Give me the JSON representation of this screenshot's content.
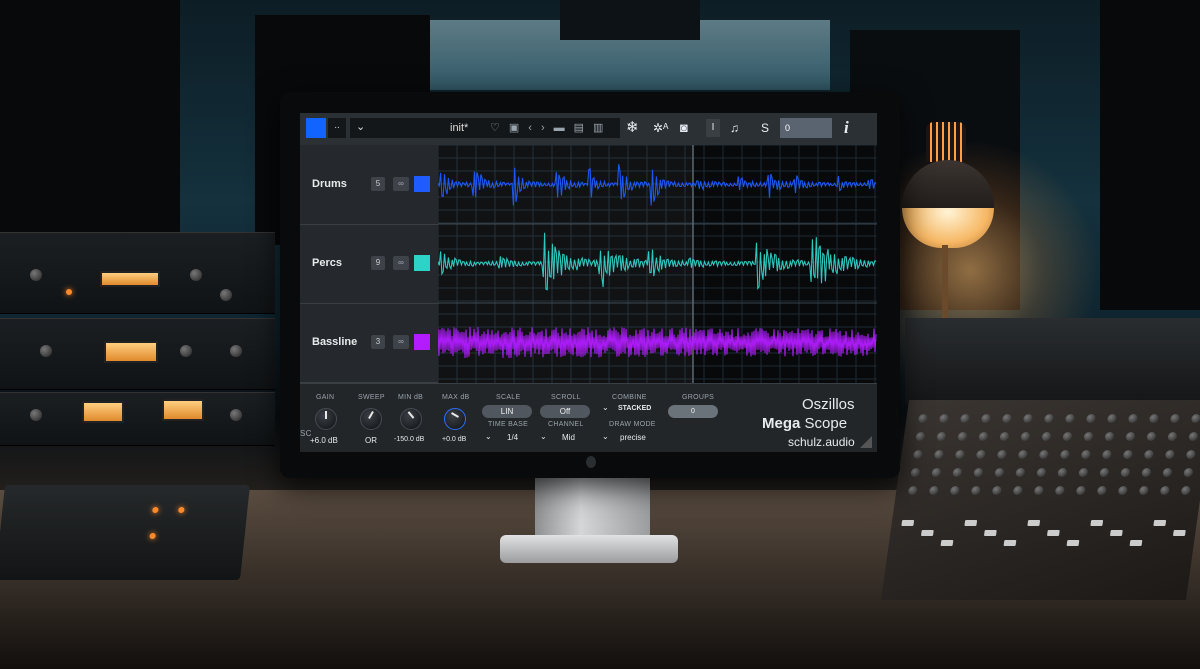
{
  "topbar": {
    "small_button": "..",
    "preset_chevron": "⌄",
    "preset_name": "init*",
    "icons": [
      "heart-icon",
      "save-icon",
      "prev-icon",
      "next-icon",
      "folder-icon",
      "copy-icon",
      "paste-icon"
    ],
    "number_field": "0"
  },
  "tracks": [
    {
      "name": "Drums",
      "num": "5",
      "link": "∞",
      "color": "#1e5cff"
    },
    {
      "name": "Percs",
      "num": "9",
      "link": "∞",
      "color": "#2ed3c8"
    },
    {
      "name": "Bassline",
      "num": "3",
      "link": "∞",
      "color": "#b21cff"
    }
  ],
  "controls": {
    "gain": {
      "label": "GAIN",
      "value": "+6.0 dB"
    },
    "sweep": {
      "label": "SWEEP",
      "value": "OR"
    },
    "min_db": {
      "label": "MIN dB",
      "value": "-150.0 dB"
    },
    "max_db": {
      "label": "MAX dB",
      "value": "+0.0 dB"
    },
    "scale": {
      "label": "SCALE",
      "value": "LIN"
    },
    "scroll": {
      "label": "SCROLL",
      "value": "Off"
    },
    "combine": {
      "label": "COMBINE",
      "value": "STACKED"
    },
    "groups": {
      "label": "GROUPS",
      "value": "0"
    },
    "time_base": {
      "label": "TIME BASE",
      "value": "1/4"
    },
    "channel": {
      "label": "CHANNEL",
      "value": "Mid"
    },
    "draw_mode": {
      "label": "DRAW MODE",
      "value": "precise"
    },
    "sc_label": "SC"
  },
  "brand": {
    "line1": "Oszillos",
    "line2_bold": "Mega",
    "line2_rest": " Scope",
    "line3": "schulz.audio"
  }
}
